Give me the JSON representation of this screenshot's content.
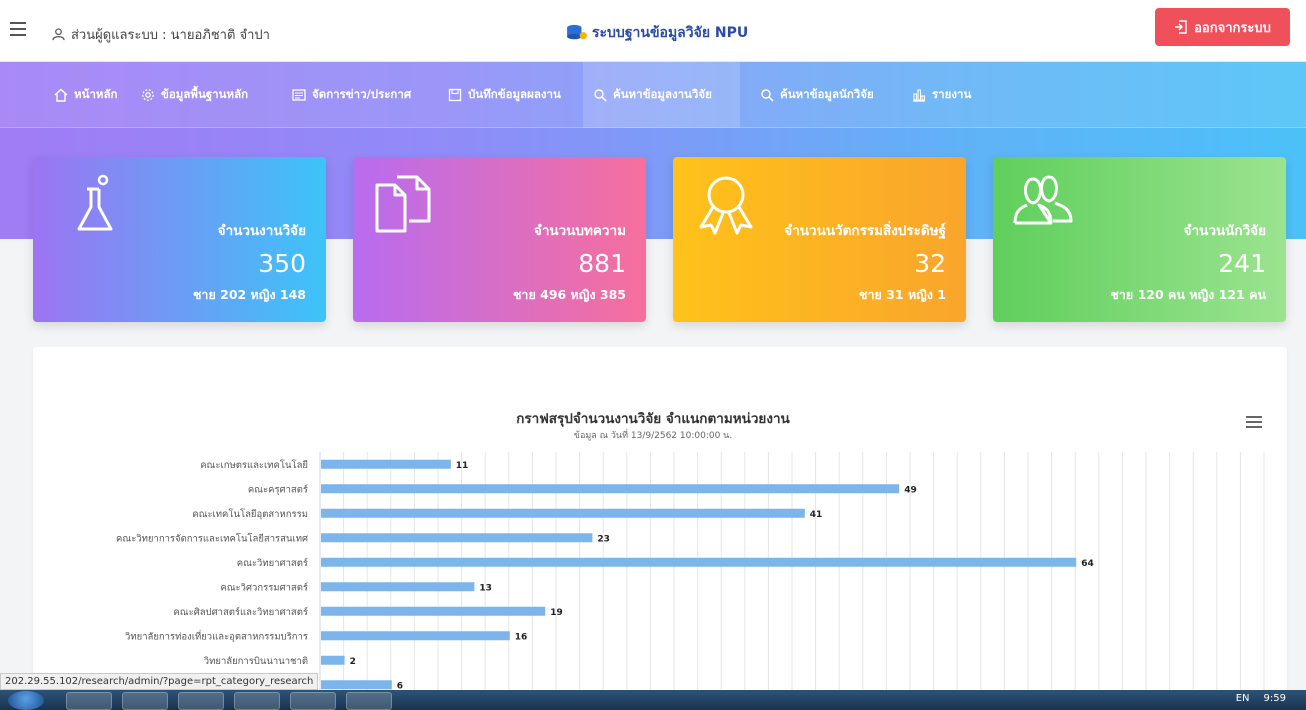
{
  "header": {
    "admin_label": "ส่วนผู้ดูแลระบบ : นายอภิชาติ จำปา",
    "brand": "ระบบฐานข้อมูลวิจัย NPU",
    "logout_label": "ออกจากระบบ"
  },
  "nav": {
    "items": [
      {
        "label": "หน้าหลัก",
        "icon": "home-icon"
      },
      {
        "label": "ข้อมูลพื้นฐานหลัก",
        "icon": "gear-icon"
      },
      {
        "label": "จัดการข่าว/ประกาศ",
        "icon": "news-icon"
      },
      {
        "label": "บันทึกข้อมูลผลงาน",
        "icon": "save-icon"
      },
      {
        "label": "ค้นหาข้อมูลงานวิจัย",
        "icon": "search-icon"
      },
      {
        "label": "ค้นหาข้อมูลนักวิจัย",
        "icon": "search-icon"
      },
      {
        "label": "รายงาน",
        "icon": "bar-chart-icon"
      }
    ],
    "active_index": 4
  },
  "cards": [
    {
      "title": "จำนวนงานวิจัย",
      "value": "350",
      "sub": "ชาย 202 หญิง 148",
      "icon": "flask-icon"
    },
    {
      "title": "จำนวนบทความ",
      "value": "881",
      "sub": "ชาย 496 หญิง 385",
      "icon": "documents-icon"
    },
    {
      "title": "จำนวนนวัตกรรมสิ่งประดิษฐ์",
      "value": "32",
      "sub": "ชาย 31 หญิง 1",
      "icon": "award-icon"
    },
    {
      "title": "จำนวนนักวิจัย",
      "value": "241",
      "sub": "ชาย 120 คน หญิง 121 คน",
      "icon": "users-icon"
    }
  ],
  "chart_data": {
    "type": "bar",
    "orientation": "horizontal",
    "title": "กราฟสรุปจำนวนงานวิจัย จำแนกตามหน่วยงาน",
    "subtitle": "ข้อมูล ณ วันที่ 13/9/2562 10:00:00 น.",
    "categories": [
      "คณะเกษตรและเทคโนโลยี",
      "คณะครุศาสตร์",
      "คณะเทคโนโลยีอุตสาหกรรม",
      "คณะวิทยาการจัดการและเทคโนโลยีสารสนเทศ",
      "คณะวิทยาศาสตร์",
      "คณะวิศวกรรมศาสตร์",
      "คณะศิลปศาสตร์และวิทยาศาสตร์",
      "วิทยาลัยการท่องเที่ยวและอุตสาหกรรมบริการ",
      "วิทยาลัยการบินนานาชาติ",
      ""
    ],
    "values": [
      11,
      49,
      41,
      23,
      64,
      13,
      19,
      16,
      2,
      6
    ],
    "xlim": [
      0,
      80
    ],
    "bar_color": "#7cb5ec",
    "grid": true
  },
  "status_url": "202.29.55.102/research/admin/?page=rpt_category_research",
  "taskbar": {
    "lang": "EN",
    "time": "9:59"
  }
}
